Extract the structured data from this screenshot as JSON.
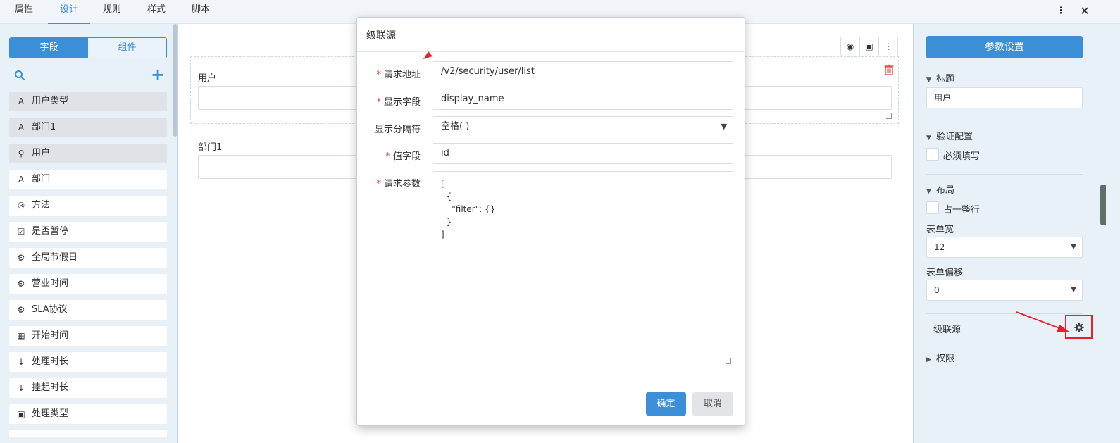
{
  "top_tabs": [
    "属性",
    "设计",
    "规则",
    "样式",
    "脚本"
  ],
  "top_icons": {
    "more": "more-vertical-icon",
    "close": "close-icon"
  },
  "left": {
    "segments": [
      "字段",
      "组件"
    ],
    "items": [
      {
        "icon": "A",
        "label": "用户类型"
      },
      {
        "icon": "A",
        "label": "部门1"
      },
      {
        "icon": "⚲",
        "label": "用户"
      },
      {
        "icon": "A",
        "label": "部门"
      },
      {
        "icon": "®",
        "label": "方法"
      },
      {
        "icon": "☑",
        "label": "是否暂停"
      },
      {
        "icon": "⚙",
        "label": "全局节假日"
      },
      {
        "icon": "⚙",
        "label": "营业时间"
      },
      {
        "icon": "⚙",
        "label": "SLA协议"
      },
      {
        "icon": "▦",
        "label": "开始时间"
      },
      {
        "icon": "↓",
        "label": "处理时长"
      },
      {
        "icon": "↓",
        "label": "挂起时长"
      },
      {
        "icon": "▣",
        "label": "处理类型"
      }
    ]
  },
  "canvas": {
    "tools": [
      "◉",
      "▣",
      "⋮"
    ],
    "field1_label": "用户",
    "field2_label": "部门1"
  },
  "right": {
    "param_button": "参数设置",
    "title_section": "标题",
    "title_value": "用户",
    "validate_section": "验证配置",
    "required_label": "必须填写",
    "layout_section": "布局",
    "full_row_label": "占一整行",
    "form_width_label": "表单宽",
    "form_width_value": "12",
    "form_offset_label": "表单偏移",
    "form_offset_value": "0",
    "cascade_label": "级联源",
    "permission_section": "权限"
  },
  "modal": {
    "title": "级联源",
    "request_url_label": "请求地址",
    "request_url_value": "/v2/security/user/list",
    "display_field_label": "显示字段",
    "display_field_value": "display_name",
    "separator_label": "显示分隔符",
    "separator_value": "空格( )",
    "value_field_label": "值字段",
    "value_field_value": "id",
    "params_label": "请求参数",
    "params_value": "[\n  {\n    \"filter\": {}\n  }\n]",
    "ok": "确定",
    "cancel": "取消"
  },
  "colors": {
    "accent": "#3b8fd6",
    "annotation": "#e8202a"
  }
}
